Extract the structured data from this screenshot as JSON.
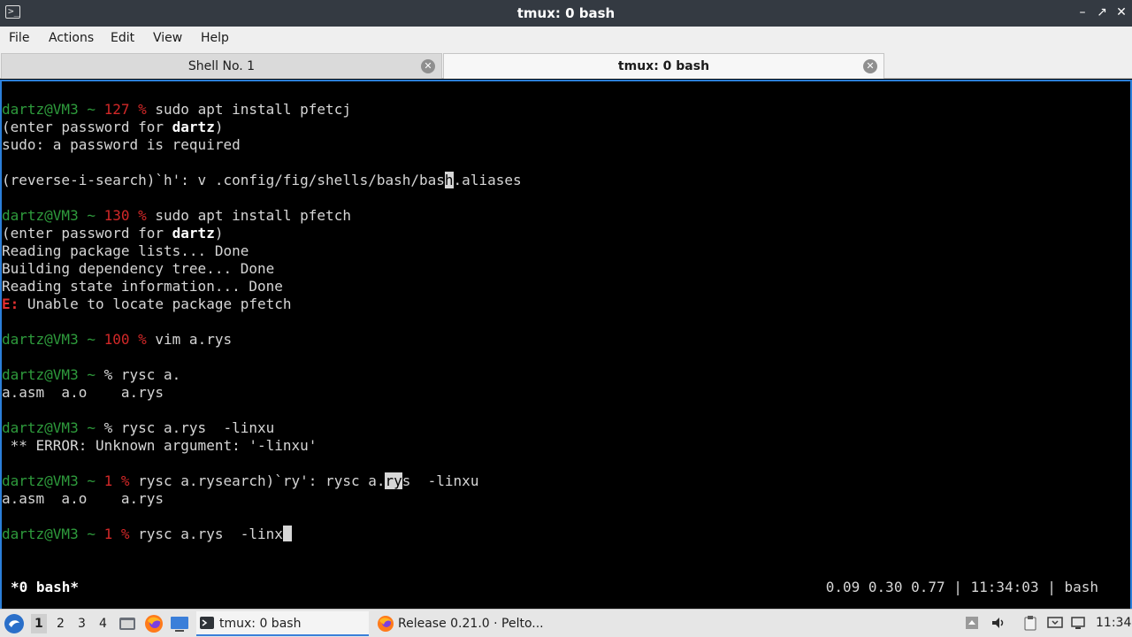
{
  "window": {
    "title": "tmux: 0 bash",
    "buttons": [
      "–",
      "↗",
      "✕"
    ]
  },
  "menu": [
    "File",
    "Actions",
    "Edit",
    "View",
    "Help"
  ],
  "tabs": [
    {
      "label": "Shell No. 1",
      "active": false
    },
    {
      "label": "tmux: 0 bash",
      "active": true
    }
  ],
  "terminal": {
    "lines": [
      {
        "user": "dartz@VM3 ~ ",
        "code": "127 %",
        "cmd": " sudo apt install pfetcj"
      },
      {
        "a": "(enter password for ",
        "b": "dartz",
        "c": ")"
      },
      {
        "text": "sudo: a password is required"
      },
      {
        "a": "(reverse-i-search)`h': v .config/fig/shells/bash/bas",
        "hl": "h",
        "c": ".aliases"
      },
      {
        "user": "dartz@VM3 ~ ",
        "code": "130 %",
        "cmd": " sudo apt install pfetch"
      },
      {
        "a": "(enter password for ",
        "b": "dartz",
        "c": ")"
      },
      {
        "text": "Reading package lists... Done"
      },
      {
        "text": "Building dependency tree... Done"
      },
      {
        "text": "Reading state information... Done"
      },
      {
        "err": "E:",
        "text": " Unable to locate package pfetch"
      },
      {
        "user": "dartz@VM3 ~ ",
        "code": "100 %",
        "cmd": " vim a.rys"
      },
      {
        "user": "dartz@VM3 ~ ",
        "code": "",
        "cmd": "% rysc a."
      },
      {
        "text": "a.asm  a.o    a.rys"
      },
      {
        "user": "dartz@VM3 ~ ",
        "code": "",
        "cmd": "% rysc a.rys  -linxu"
      },
      {
        "text": " ** ERROR: Unknown argument: '-linxu'"
      },
      {
        "user": "dartz@VM3 ~ ",
        "code": "1 %",
        "cmd1": " rysc a.rysearch)`ry': rysc a.",
        "hl": "ry",
        "cmd2": "s  -linxu"
      },
      {
        "text": "a.asm  a.o    a.rys"
      },
      {
        "user": "dartz@VM3 ~ ",
        "code": "1 %",
        "cmd": " rysc a.rys  -linx"
      }
    ],
    "status_left": "*0 bash*",
    "status_right": "0.09 0.30 0.77 | 11:34:03 | bash"
  },
  "taskbar": {
    "workspaces": [
      "1",
      "2",
      "3",
      "4"
    ],
    "tasks": [
      {
        "label": "tmux: 0 bash",
        "active": true
      },
      {
        "label": "Release 0.21.0 · Pelto...",
        "active": false
      }
    ],
    "clock": "11:34"
  },
  "colors": {
    "prompt_user": "#2e9b3c",
    "exit_code": "#d22828",
    "accent": "#2b7fd9"
  }
}
